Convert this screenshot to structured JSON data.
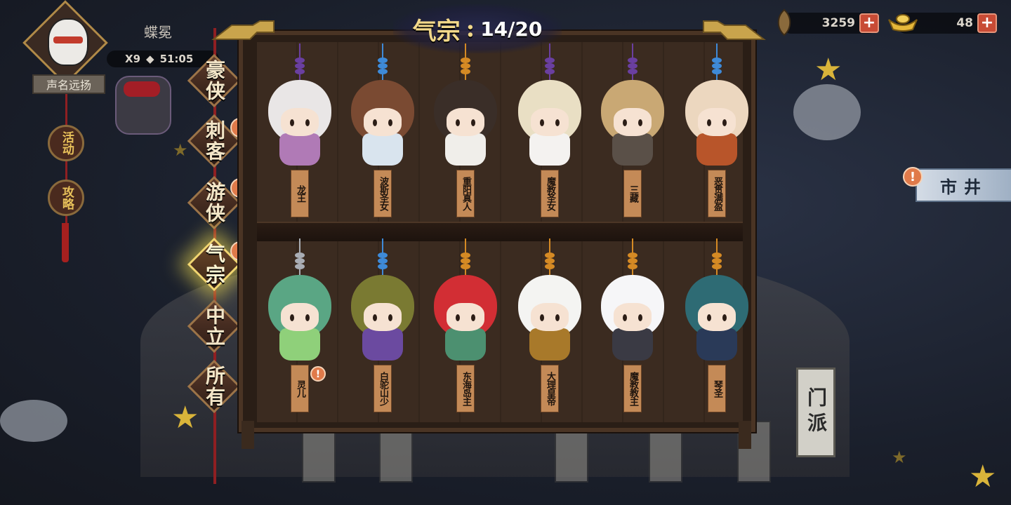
{
  "player": {
    "name": "蝶冕",
    "multiplier": "X9",
    "timer": "51:05",
    "title": "声名远扬"
  },
  "side_buttons": [
    {
      "label": "活动"
    },
    {
      "label": "攻略"
    }
  ],
  "menu": [
    {
      "label": "豪侠",
      "alert": ""
    },
    {
      "label": "刺客",
      "alert": "!"
    },
    {
      "label": "游侠",
      "alert": "!"
    },
    {
      "label": "气宗",
      "alert": "!"
    },
    {
      "label": "中立",
      "alert": ""
    },
    {
      "label": "所有",
      "alert": ""
    }
  ],
  "collection": {
    "title": "气宗",
    "progress": "14/20",
    "collected": 14,
    "total": 20
  },
  "resources": {
    "copper": "3259",
    "gold": "48",
    "plus": "+"
  },
  "market": {
    "label": "市井",
    "alert": "!"
  },
  "sect": {
    "label": "门派"
  },
  "characters_row1": [
    {
      "name": "龙王",
      "bead": "#6a3fa0",
      "head": "#e9e6e6",
      "body": "#b07ab6"
    },
    {
      "name": "波斯圣女",
      "bead": "#3e8ad8",
      "head": "#7a4a32",
      "body": "#d9e4ee"
    },
    {
      "name": "重阳真人",
      "bead": "#d58a24",
      "head": "#3a2e28",
      "body": "#f0eeea"
    },
    {
      "name": "魔教圣女",
      "bead": "#6a3fa0",
      "head": "#e9dfc4",
      "body": "#f4f2f0"
    },
    {
      "name": "三藏",
      "bead": "#6a3fa0",
      "head": "#c9a874",
      "body": "#5a5048"
    },
    {
      "name": "恶贯满盈",
      "bead": "#3e8ad8",
      "head": "#ecd7bf",
      "body": "#b8552a"
    }
  ],
  "characters_row2": [
    {
      "name": "灵儿",
      "bead": "#a9adb4",
      "head": "#5aa684",
      "body": "#8fd07a",
      "alert": "!"
    },
    {
      "name": "白驼山少",
      "bead": "#3e8ad8",
      "head": "#7a7a32",
      "body": "#6b4aa0"
    },
    {
      "name": "东海岛主",
      "bead": "#d58a24",
      "head": "#d22e34",
      "body": "#4c9070"
    },
    {
      "name": "大理皇帝",
      "bead": "#d58a24",
      "head": "#f4f4f2",
      "body": "#a8792a"
    },
    {
      "name": "魔教教主",
      "bead": "#d58a24",
      "head": "#f6f6f8",
      "body": "#3a3a44"
    },
    {
      "name": "琴圣",
      "bead": "#d58a24",
      "head": "#2e6b74",
      "body": "#2a3a58"
    }
  ]
}
